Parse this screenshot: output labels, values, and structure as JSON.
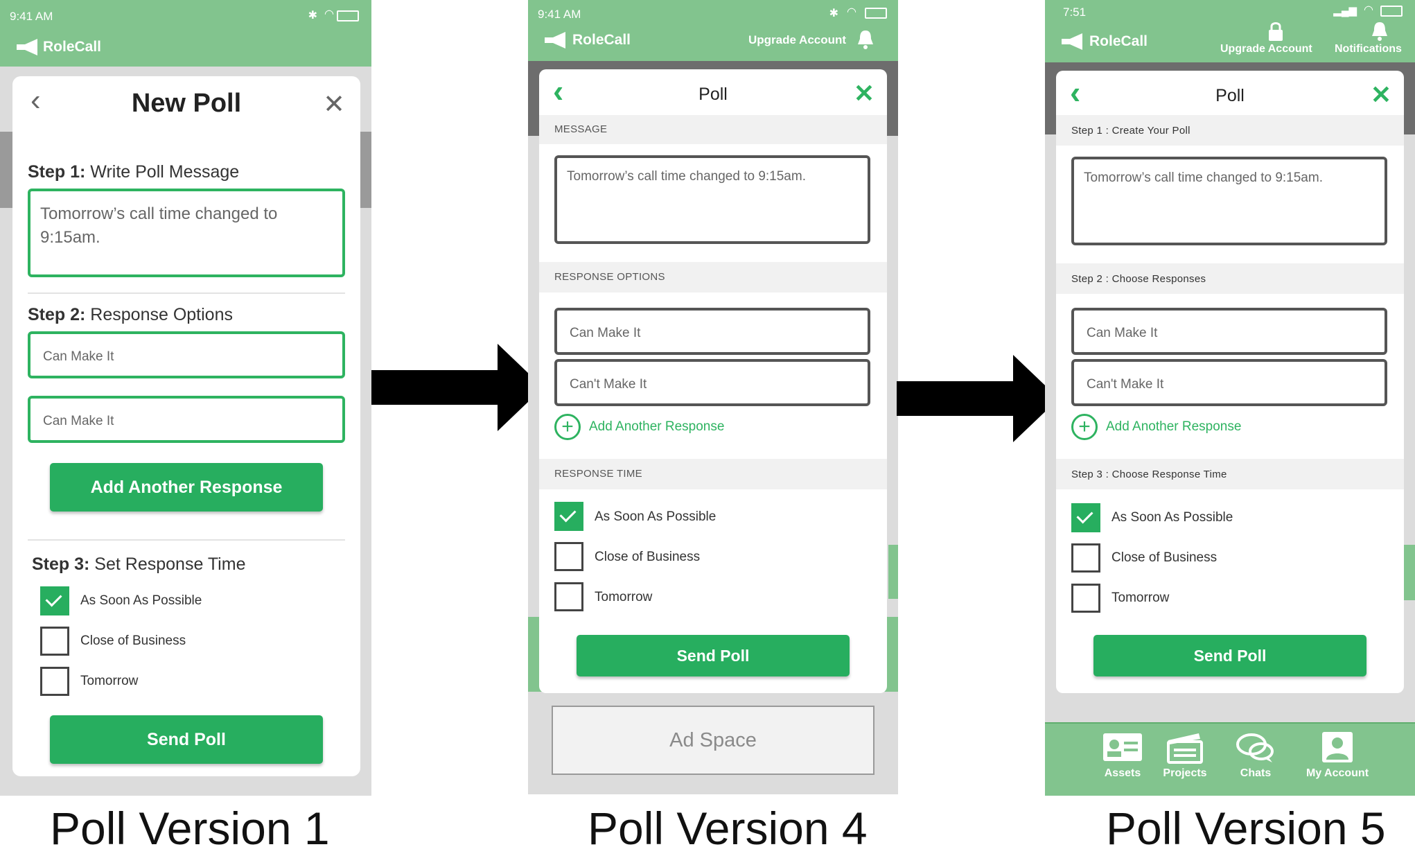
{
  "v1": {
    "status": {
      "time": "9:41 AM"
    },
    "app": {
      "brand": "RoleCall"
    },
    "header": {
      "title": "New Poll"
    },
    "step1": {
      "bold": "Step 1:",
      "text": " Write Poll Message"
    },
    "message": "Tomorrow’s call time changed to 9:15am.",
    "step2": {
      "bold": "Step 2:",
      "text": " Response Options"
    },
    "responses": [
      "Can Make It",
      "Can Make It"
    ],
    "add_button": "Add Another Response",
    "step3": {
      "bold": "Step 3:",
      "text": " Set Response Time"
    },
    "times": [
      "As Soon As Possible",
      "Close of Business",
      "Tomorrow"
    ],
    "send_button": "Send Poll",
    "caption": "Poll Version 1"
  },
  "v4": {
    "status": {
      "time": "9:41 AM"
    },
    "app": {
      "brand": "RoleCall",
      "upgrade": "Upgrade Account"
    },
    "header": {
      "title": "Poll"
    },
    "sections": {
      "message": "MESSAGE",
      "responses": "RESPONSE OPTIONS",
      "time": "RESPONSE TIME"
    },
    "message": "Tomorrow’s call time changed to 9:15am.",
    "responses": [
      "Can Make It",
      "Can't Make It"
    ],
    "add_link": "Add Another Response",
    "times": [
      "As Soon As Possible",
      "Close of Business",
      "Tomorrow"
    ],
    "send_button": "Send Poll",
    "ad": "Ad Space",
    "caption": "Poll Version 4"
  },
  "v5": {
    "status": {
      "time": "7:51"
    },
    "app": {
      "brand": "RoleCall",
      "upgrade": "Upgrade Account",
      "notifications": "Notifications"
    },
    "header": {
      "title": "Poll"
    },
    "sections": {
      "step1": "Step 1 : Create Your Poll",
      "step2": "Step 2 : Choose Responses",
      "step3": "Step 3 : Choose Response Time"
    },
    "message": "Tomorrow’s call time changed to 9:15am.",
    "responses": [
      "Can Make It",
      "Can't Make It"
    ],
    "add_link": "Add Another Response",
    "times": [
      "As Soon As Possible",
      "Close of Business",
      "Tomorrow"
    ],
    "send_button": "Send Poll",
    "tabs": [
      "Assets",
      "Projects",
      "Chats",
      "My Account"
    ],
    "caption": "Poll Version 5"
  },
  "colors": {
    "brand_green": "#82c48e",
    "accent_green": "#27ae5f"
  }
}
